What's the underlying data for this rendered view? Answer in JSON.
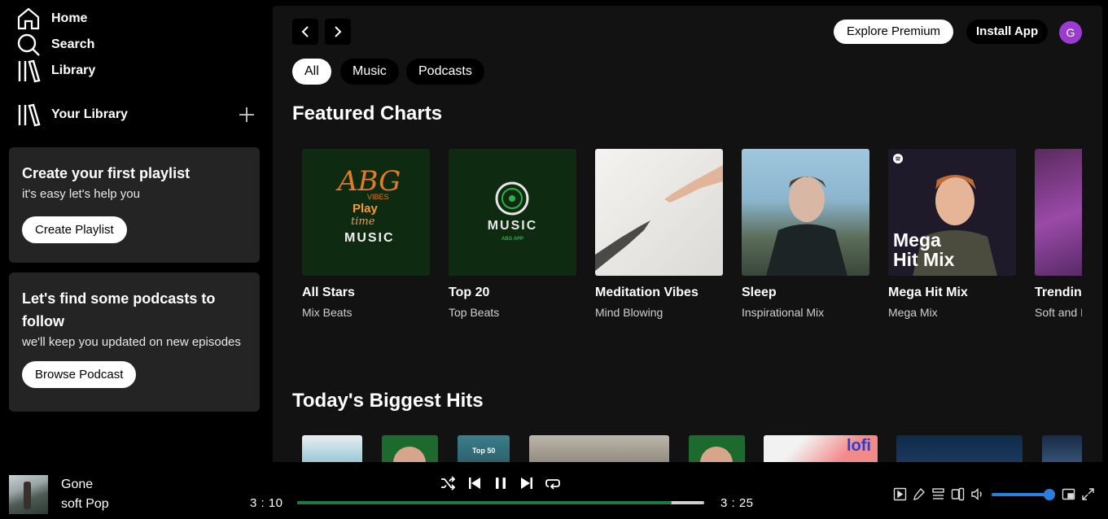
{
  "nav": {
    "home": "Home",
    "search": "Search",
    "library": "Library"
  },
  "your_library": {
    "label": "Your Library"
  },
  "playlist_card": {
    "title": "Create your first playlist",
    "subtitle": "it's easy let's help you",
    "button": "Create Playlist"
  },
  "podcast_card": {
    "title": "Let's find some podcasts to follow",
    "subtitle": "we'll keep you updated on new episodes",
    "button": "Browse Podcast"
  },
  "header": {
    "premium": "Explore Premium",
    "install": "Install App",
    "avatar_letter": "G"
  },
  "filters": [
    "All",
    "Music",
    "Podcasts"
  ],
  "sections": {
    "featured": "Featured Charts",
    "biggest": "Today's Biggest Hits"
  },
  "featured_tiles": [
    {
      "title": "All Stars",
      "subtitle": "Mix Beats",
      "art_text": [
        "ABG",
        "VIBES",
        "Play",
        "time",
        "MUSIC"
      ]
    },
    {
      "title": "Top 20",
      "subtitle": "Top Beats",
      "art_text": [
        "MUSIC",
        "ABG APP"
      ]
    },
    {
      "title": "Meditation Vibes",
      "subtitle": "Mind Blowing"
    },
    {
      "title": "Sleep",
      "subtitle": "Inspirational Mix"
    },
    {
      "title": "Mega Hit Mix",
      "subtitle": "Mega Mix",
      "art_text": [
        "Mega",
        "Hit Mix"
      ]
    },
    {
      "title": "Trending",
      "subtitle": "Soft and I"
    }
  ],
  "biggest_tiles": [
    {
      "art_text": ""
    },
    {
      "art_text": ""
    },
    {
      "art_text": "Top 50"
    },
    {
      "art_text": ""
    },
    {
      "art_text": ""
    },
    {
      "art_text": "lofi"
    },
    {
      "art_text": ""
    },
    {
      "art_text": ""
    }
  ],
  "now_playing": {
    "title": "Gone",
    "artist": "soft Pop",
    "elapsed": "3 : 10",
    "duration": "3 : 25",
    "progress": 0.92,
    "volume": 0.95
  },
  "colors": {
    "accent_progress": "#1d7a42",
    "volume": "#2a7fdc",
    "avatar": "#9b3bd0"
  }
}
